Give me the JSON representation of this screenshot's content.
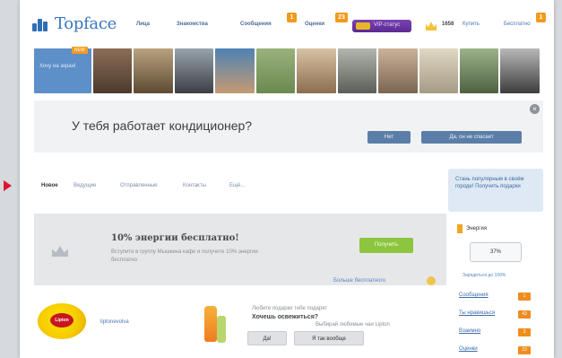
{
  "header": {
    "logo_text": "Topface",
    "nav": [
      "Лица",
      "Знакомства",
      "Сообщения",
      "Оценки"
    ],
    "nav_badges": {
      "messages": "1",
      "ratings": "23"
    },
    "vip_label": "VIP-статус",
    "balance": "1658",
    "buy_label": "Купить",
    "free_label": "Бесплатно",
    "free_badge": "1"
  },
  "strip": {
    "me_label": "Хочу на экран!",
    "me_tag": "NEW"
  },
  "question": {
    "text": "У тебя работает кондиционер?",
    "close": "×",
    "buttons": [
      "Нет",
      "Да, он не спасает"
    ]
  },
  "tabs": [
    "Новое",
    "Ведущие",
    "Отправленные",
    "Контакты",
    "Ещё..."
  ],
  "promo": {
    "title": "10% энергии бесплатно!",
    "desc": "Вступите в группу Мышкина кафе и получите 10% энергии бесплатно",
    "button": "Получить",
    "more": "Больше бесплатного"
  },
  "ad": {
    "brand": "Lipton",
    "name": "liptonevolva",
    "line1": "Любите подарки тебе подарят",
    "title": "Хочешь освежиться?",
    "line2": "Выбирай любимые чаи Lipton",
    "buttons": [
      "Да!",
      "Я так вообще"
    ]
  },
  "sidebar": {
    "promo_text": "Стань популярным в своём городе! Получить подарки",
    "rating_label": "Энергия",
    "rating_value": "37%",
    "rating_up": "Зарядиться до 100%",
    "links": [
      {
        "label": "Сообщения",
        "badge": "1"
      },
      {
        "label": "Ты нравишься",
        "badge": "43"
      },
      {
        "label": "Взаимно",
        "badge": "3"
      },
      {
        "label": "Оценки",
        "badge": "23"
      }
    ]
  },
  "colors": {
    "accent": "#3a78c0",
    "marker": "#e0152d",
    "badge": "#f29a1d",
    "promo_button": "#8cc63e"
  }
}
